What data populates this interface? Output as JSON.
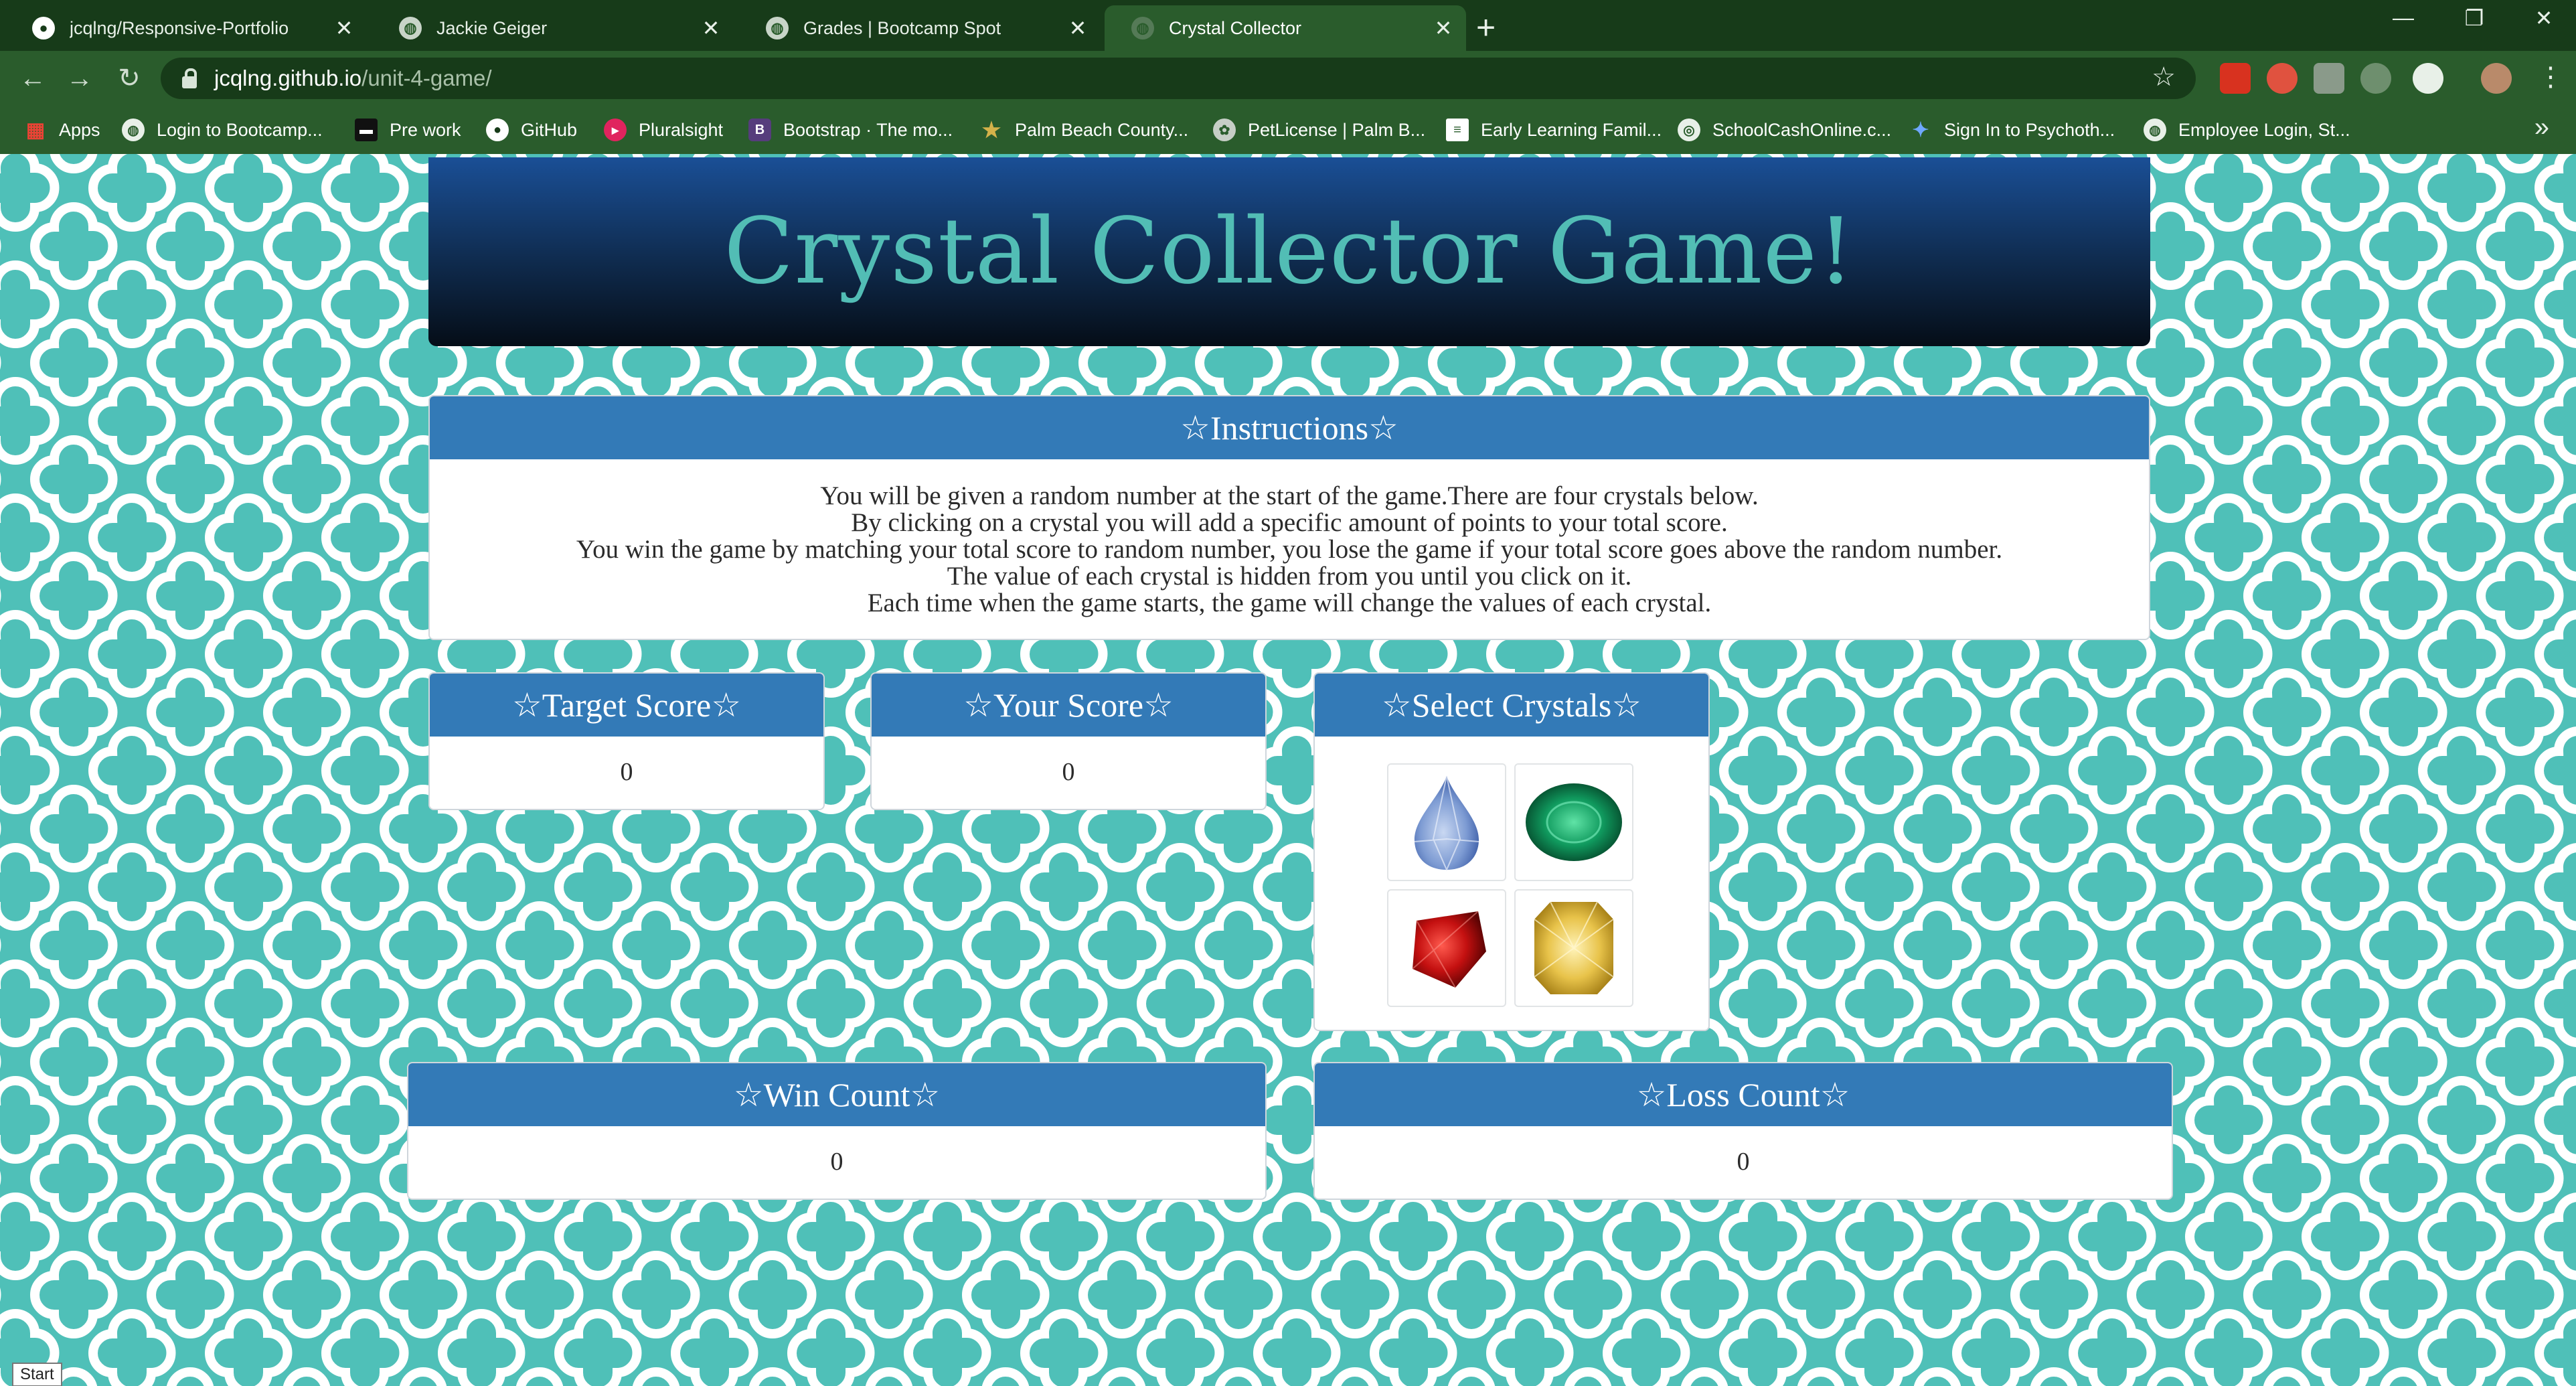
{
  "browser": {
    "tabs": [
      {
        "title": "jcqlng/Responsive-Portfolio",
        "icon": "github-icon",
        "active": false
      },
      {
        "title": "Jackie Geiger",
        "icon": "globe-icon",
        "active": false
      },
      {
        "title": "Grades | Bootcamp Spot",
        "icon": "globe-icon",
        "active": false
      },
      {
        "title": "Crystal Collector",
        "icon": "globe-icon",
        "active": true
      }
    ],
    "new_tab_label": "+",
    "url_host": "jcqlng.github.io",
    "url_path": "/unit-4-game/",
    "bookmarks": [
      {
        "label": "Apps",
        "icon": "apps-grid-icon"
      },
      {
        "label": "Login to Bootcamp...",
        "icon": "globe-icon"
      },
      {
        "label": "Pre work",
        "icon": "note-icon"
      },
      {
        "label": "GitHub",
        "icon": "github-icon"
      },
      {
        "label": "Pluralsight",
        "icon": "pluralsight-icon"
      },
      {
        "label": "Bootstrap · The mo...",
        "icon": "bootstrap-icon"
      },
      {
        "label": "Palm Beach County...",
        "icon": "sheriff-star-icon"
      },
      {
        "label": "PetLicense | Palm B...",
        "icon": "paw-icon"
      },
      {
        "label": "Early Learning Famil...",
        "icon": "document-icon"
      },
      {
        "label": "SchoolCashOnline.c...",
        "icon": "school-cash-icon"
      },
      {
        "label": "Sign In to Psychoth...",
        "icon": "bird-icon"
      },
      {
        "label": "Employee Login, St...",
        "icon": "globe-icon"
      }
    ],
    "bookmarks_more": "»"
  },
  "page": {
    "title": "Crystal Collector Game!",
    "instructions": {
      "heading": "☆Instructions☆",
      "lines": [
        "You will be given a random number at the start of the game.There are four crystals below.",
        "By clicking on a crystal you will add a specific amount of points to your total score.",
        "You win the game by matching your total score to random number, you lose the game if your total score goes above the random number.",
        "The value of each crystal is hidden from you until you click on it.",
        "Each time when the game starts, the game will change the values of each crystal."
      ]
    },
    "target": {
      "heading": "☆Target Score☆",
      "value": "0"
    },
    "your_score": {
      "heading": "☆Your Score☆",
      "value": "0"
    },
    "crystals": {
      "heading": "☆Select Crystals☆",
      "items": [
        {
          "name": "blue-diamond",
          "color": "#5b7fc4"
        },
        {
          "name": "green-emerald",
          "color": "#0f8a55"
        },
        {
          "name": "red-ruby",
          "color": "#c41010"
        },
        {
          "name": "yellow-diamond",
          "color": "#e2b93b"
        }
      ]
    },
    "wins": {
      "heading": "☆Win Count☆",
      "value": "0"
    },
    "losses": {
      "heading": "☆Loss Count☆",
      "value": "0"
    },
    "status_button": "Start"
  },
  "colors": {
    "page_background": "#4fc0b8",
    "lattice": "#ffffff",
    "panel_header": "#337ab7",
    "title_text": "#52bdb5",
    "chrome_dark": "#173b19",
    "chrome": "#2a5c2c"
  }
}
